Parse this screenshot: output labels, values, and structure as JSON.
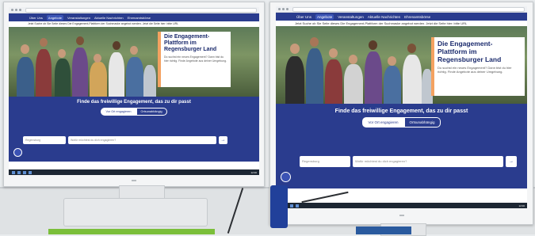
{
  "website": {
    "nav_items": [
      "Über Uns",
      "Angebote",
      "Veranstaltungen",
      "Aktuelle Nachrichten",
      "Ehrenamtsbörse"
    ],
    "banner_text": "Jetzt Suche ob Sie Seite dieses Die Engagement-Plattform der Suchmaske angebot werden. Jetzt die Seite hier: bitte URL",
    "hero": {
      "title": "Die Engagement-Plattform im Regensburger Land",
      "description": "Du suchst ein neues Engagement? Dann bist du hier richtig. Finde Angebote aus deiner Umgebung."
    },
    "search": {
      "heading": "Finde das freiwillige Engagement, das zu dir passt",
      "toggle_on": "Vor Ort engagieren",
      "toggle_off": "Ortsunabhängig",
      "where_placeholder": "Regensburg",
      "what_placeholder": "Wofür möchtest du dich engagieren?",
      "submit_glyph": "→"
    }
  },
  "colors": {
    "primary": "#2a3c8e",
    "accent": "#f4a261",
    "hero_green": "#6b8a5a"
  },
  "taskbar": {
    "clock": "12:00"
  }
}
